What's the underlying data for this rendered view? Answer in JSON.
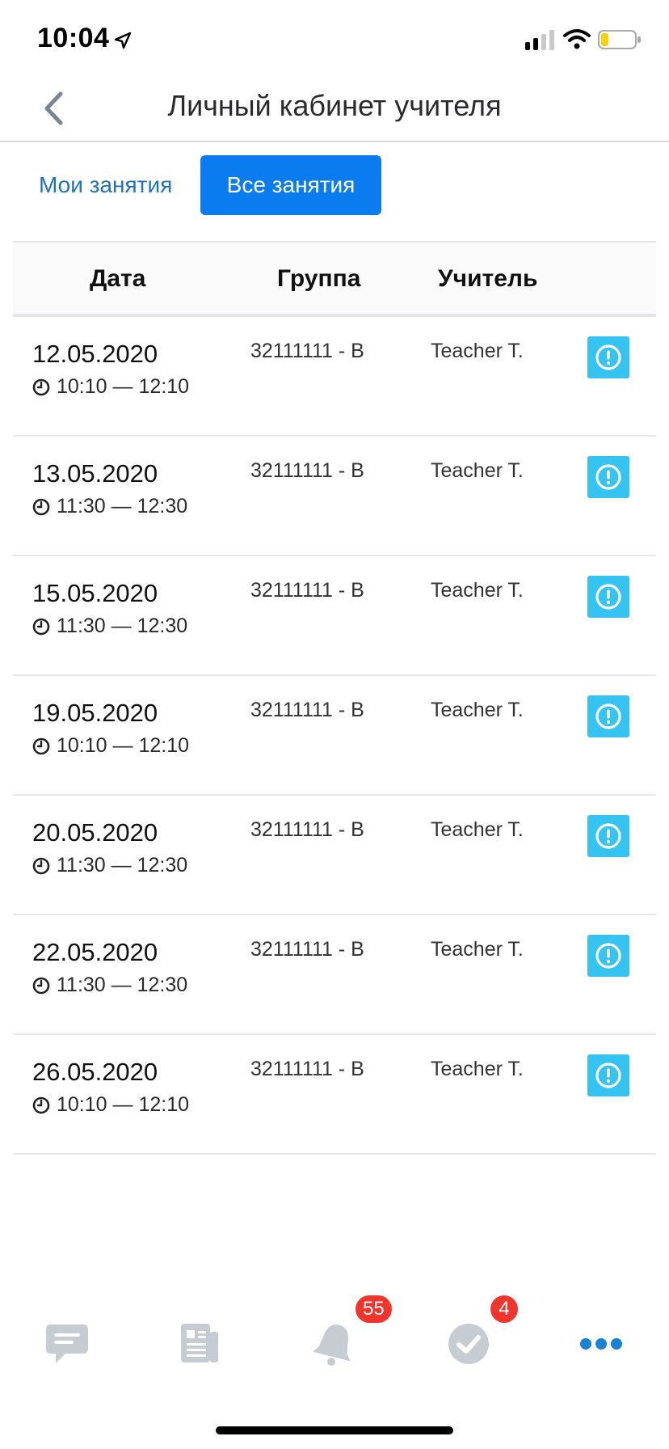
{
  "status_bar": {
    "time": "10:04",
    "icons": [
      "location-arrow-icon",
      "signal-icon",
      "wifi-icon",
      "battery-low-icon"
    ]
  },
  "nav": {
    "title": "Личный кабинет учителя",
    "back_icon": "chevron-left-icon"
  },
  "tabs": {
    "mine": "Мои занятия",
    "all": "Все занятия",
    "active": "all"
  },
  "table": {
    "headers": {
      "date": "Дата",
      "group": "Группа",
      "teacher": "Учитель"
    },
    "rows": [
      {
        "date": "12.05.2020",
        "time": "10:10 — 12:10",
        "group": "32111111 - B",
        "teacher": "Teacher T."
      },
      {
        "date": "13.05.2020",
        "time": "11:30 — 12:30",
        "group": "32111111 - B",
        "teacher": "Teacher T."
      },
      {
        "date": "15.05.2020",
        "time": "11:30 — 12:30",
        "group": "32111111 - B",
        "teacher": "Teacher T."
      },
      {
        "date": "19.05.2020",
        "time": "10:10 — 12:10",
        "group": "32111111 - B",
        "teacher": "Teacher T."
      },
      {
        "date": "20.05.2020",
        "time": "11:30 — 12:30",
        "group": "32111111 - B",
        "teacher": "Teacher T."
      },
      {
        "date": "22.05.2020",
        "time": "11:30 — 12:30",
        "group": "32111111 - B",
        "teacher": "Teacher T."
      },
      {
        "date": "26.05.2020",
        "time": "10:10 — 12:10",
        "group": "32111111 - B",
        "teacher": "Teacher T."
      }
    ]
  },
  "tab_bar": {
    "items": [
      {
        "icon": "chat-icon"
      },
      {
        "icon": "news-icon"
      },
      {
        "icon": "bell-icon",
        "badge": "55"
      },
      {
        "icon": "check-icon",
        "badge": "4"
      },
      {
        "icon": "more-icon",
        "active": true
      }
    ]
  },
  "colors": {
    "accent": "#0a7cf0",
    "link": "#1e73be",
    "info_button": "#35c4f1",
    "badge": "#f0352d",
    "inactive_icon": "#c7ccd3"
  }
}
